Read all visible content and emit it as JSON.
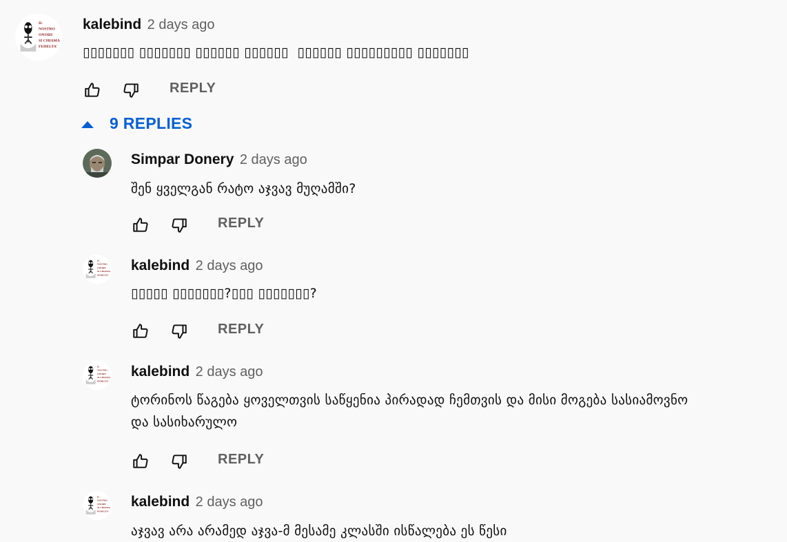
{
  "comments": [
    {
      "author": "kalebind",
      "time": "2 days ago",
      "text": "▯▯▯▯▯▯▯ ▯▯▯▯▯▯▯ ▯▯▯▯▯▯ ▯▯▯▯▯▯  ▯▯▯▯▯▯ ▯▯▯▯▯▯▯▯▯ ▯▯▯▯▯▯▯",
      "reply_label": "REPLY",
      "avatar_text": [
        "IL",
        "NOSTRO",
        "ONORE",
        "SI CHIAMA",
        "FEDELTA'"
      ]
    }
  ],
  "replies_toggle": {
    "label": "9 REPLIES"
  },
  "replies": [
    {
      "author": "Simpar Donery",
      "time": "2 days ago",
      "text": "შენ ყველგან რატო აჯვავ მუღამში?",
      "reply_label": "REPLY",
      "avatar": "photo"
    },
    {
      "author": "kalebind",
      "time": "2 days ago",
      "text": "▯▯▯▯▯ ▯▯▯▯▯▯▯?▯▯▯ ▯▯▯▯▯▯▯?",
      "reply_label": "REPLY",
      "avatar": "emblem"
    },
    {
      "author": "kalebind",
      "time": "2 days ago",
      "text": "ტორინოს წაგება ყოველთვის საწყენია პირადად ჩემთვის და მისი მოგება სასიამოვნო\nდა სასიხარულო",
      "reply_label": "REPLY",
      "avatar": "emblem"
    },
    {
      "author": "kalebind",
      "time": "2 days ago",
      "text": "აჯვავ არა არამედ აჯვა-მ მესამე კლასში ისწალება ეს წესი",
      "reply_label": "REPLY",
      "avatar": "emblem"
    }
  ],
  "icons": {
    "like": "thumbs-up-icon",
    "dislike": "thumbs-down-icon",
    "collapse": "triangle-up-icon"
  },
  "colors": {
    "background": "#f9f9f9",
    "link_blue": "#065fd4",
    "secondary_text": "#606060",
    "primary_text": "#0f0f0f"
  }
}
